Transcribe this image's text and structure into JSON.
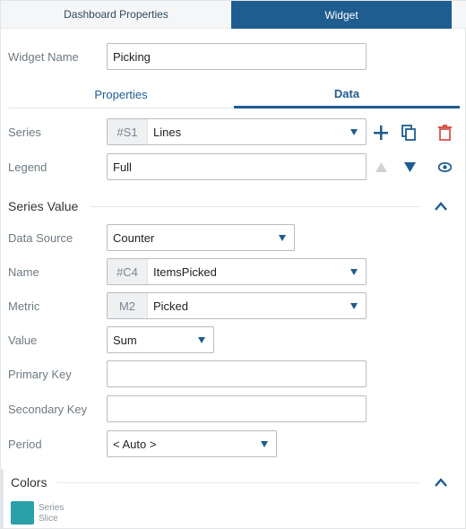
{
  "tabs": {
    "dashboard_properties": "Dashboard Properties",
    "widget": "Widget"
  },
  "widget_name": {
    "label": "Widget Name",
    "value": "Picking"
  },
  "subtabs": {
    "properties": "Properties",
    "data": "Data"
  },
  "series": {
    "label": "Series",
    "tag": "#S1",
    "value": "Lines"
  },
  "legend": {
    "label": "Legend",
    "value": "Full"
  },
  "series_value": {
    "title": "Series Value",
    "data_source": {
      "label": "Data Source",
      "value": "Counter"
    },
    "name": {
      "label": "Name",
      "tag": "#C4",
      "value": "ItemsPicked"
    },
    "metric": {
      "label": "Metric",
      "tag": "M2",
      "value": "Picked"
    },
    "value": {
      "label": "Value",
      "value": "Sum"
    },
    "primary_key": {
      "label": "Primary Key",
      "value": ""
    },
    "secondary_key": {
      "label": "Secondary Key",
      "value": ""
    },
    "period": {
      "label": "Period",
      "value": "< Auto >"
    }
  },
  "colors": {
    "title": "Colors",
    "swatch_color": "#2aa0a8",
    "line1": "Series",
    "line2": "Slice"
  },
  "accent_color": "#1f5c8f",
  "delete_color": "#d9534f"
}
